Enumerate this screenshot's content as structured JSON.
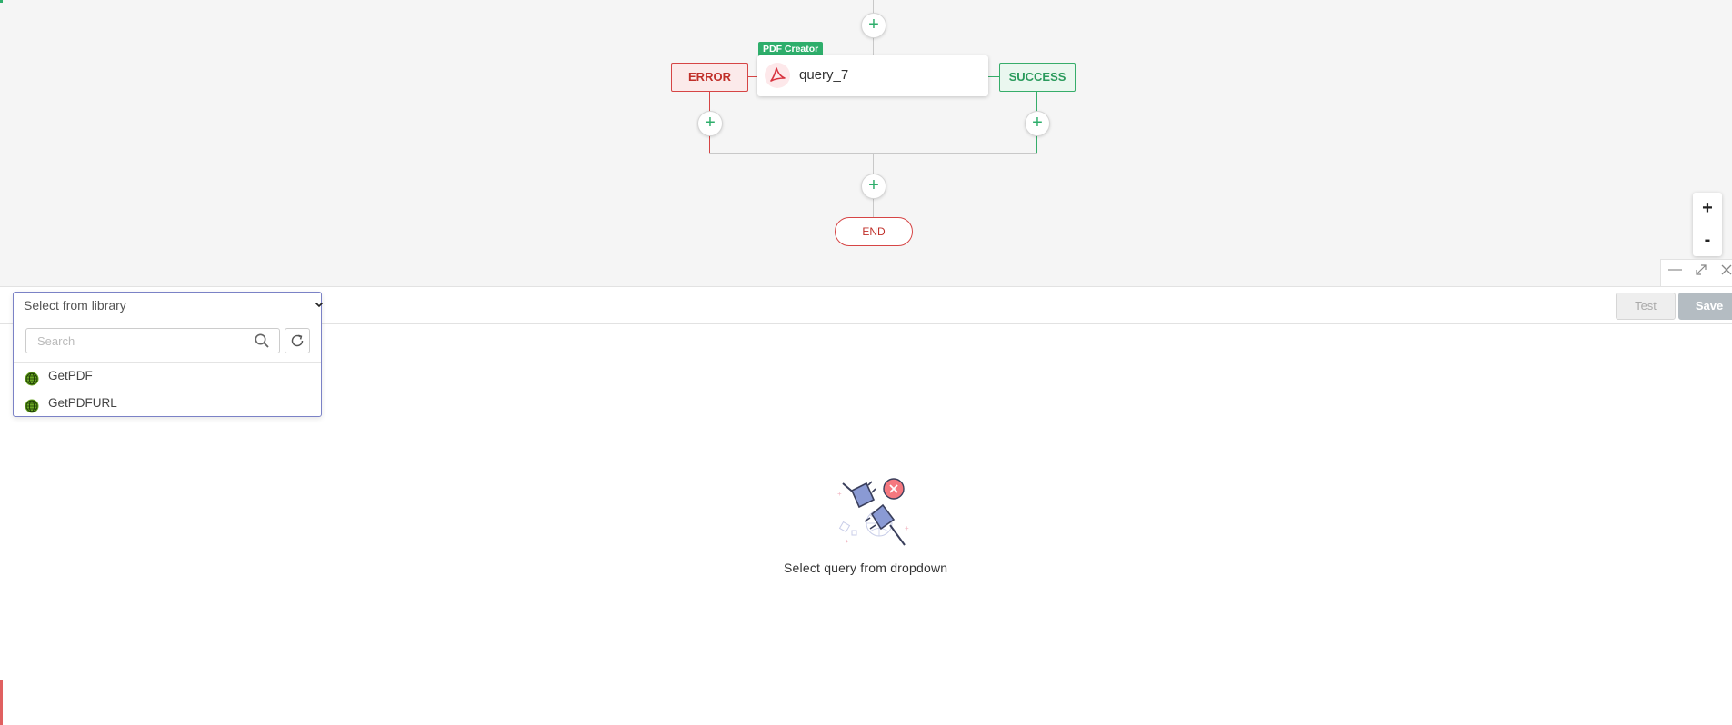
{
  "flow": {
    "node": {
      "tag": "PDF Creator",
      "title": "query_7"
    },
    "error_label": "ERROR",
    "success_label": "SUCCESS",
    "end_label": "END",
    "add_symbol": "+"
  },
  "zoom": {
    "in": "+",
    "out": "-"
  },
  "toolbar": {
    "test_label": "Test",
    "save_label": "Save"
  },
  "library": {
    "select_label": "Select from library",
    "search_placeholder": "Search",
    "items": [
      {
        "label": "GetPDF",
        "icon": "globe-icon"
      },
      {
        "label": "GetPDFURL",
        "icon": "globe-icon"
      }
    ]
  },
  "empty_state": {
    "message": "Select query from dropdown"
  },
  "colors": {
    "success": "#2eae6b",
    "error": "#d64545",
    "accent": "#7b82c6"
  }
}
